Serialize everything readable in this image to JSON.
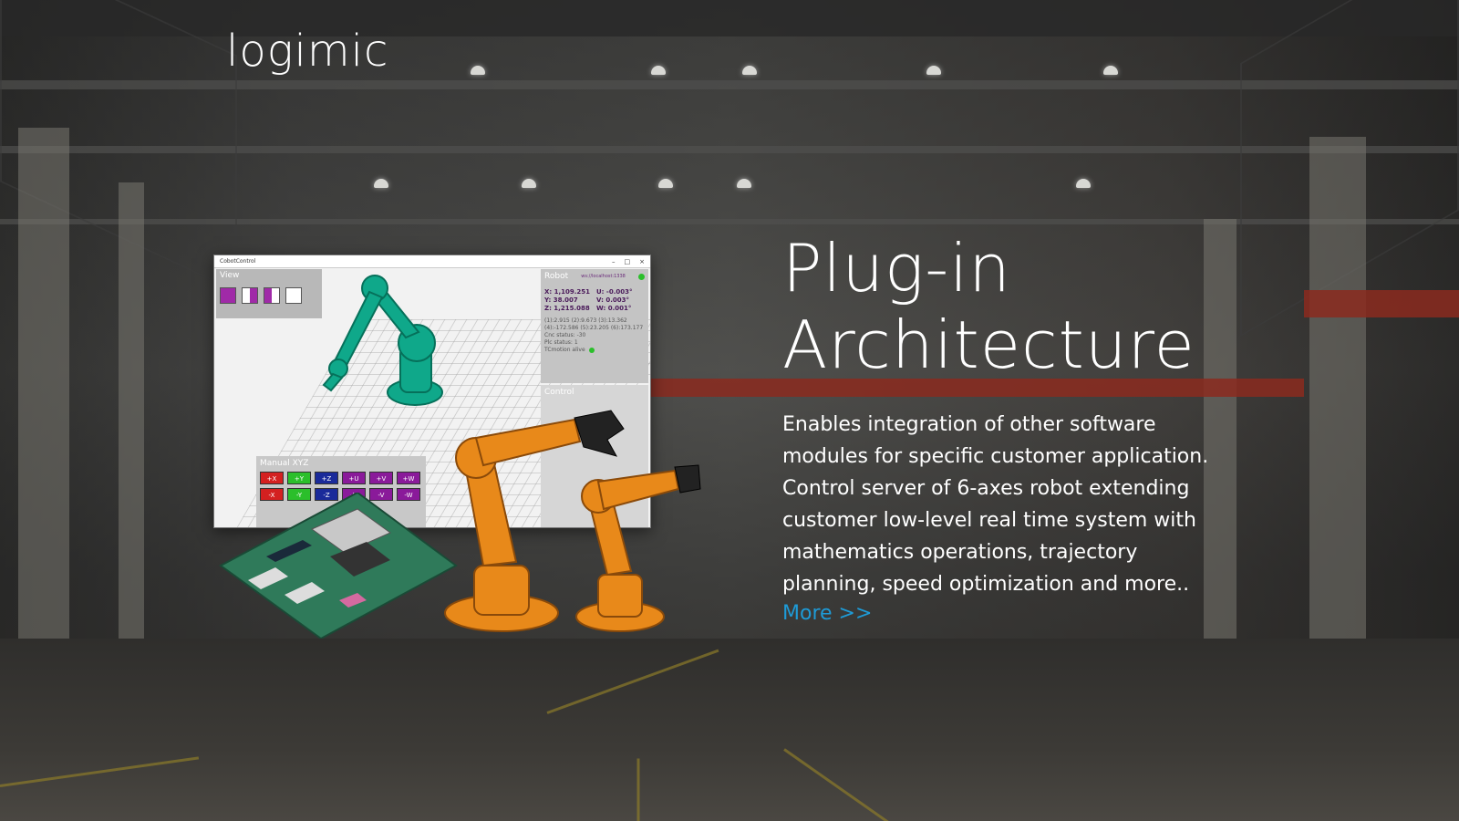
{
  "brand": {
    "logo_text": "logimic"
  },
  "hero": {
    "title_line1": "Plug-in",
    "title_line2": "Architecture",
    "description_lines": [
      "Enables integration of  other software",
      "modules for specific customer application.",
      "Control server of 6-axes robot extending",
      "customer low-level real time system with",
      "mathematics operations, trajectory",
      "planning, speed optimization and more.."
    ],
    "more_link": "More >>",
    "link_color": "#1e9bd7"
  },
  "app_window": {
    "title": "CobotControl",
    "window_controls": [
      "–",
      "□",
      "×"
    ],
    "view_panel_title": "View",
    "robot_panel": {
      "title": "Robot",
      "connection": "ws://localhost:1338",
      "coords": [
        "X: 1,109.251",
        "U: -0.003°",
        "Y: 38.007",
        "V: 0.003°",
        "Z: 1,215.088",
        "W: 0.001°"
      ],
      "joints_line1": "(1):2.915   (2):9.673   (3):13.362",
      "joints_line2": "(4):-172.586 (5):23.205 (6):173.177",
      "cnc_status": "Cnc status: -30",
      "plc_status": "Plc status: 1",
      "motion_alive": "TCmotion alive"
    },
    "control_panel_title": "Control",
    "manual_panel_title": "Manual XYZ",
    "jog_buttons": [
      {
        "label": "+X",
        "color": "#d42020"
      },
      {
        "label": "+Y",
        "color": "#2bbf2b"
      },
      {
        "label": "+Z",
        "color": "#1a2a9a"
      },
      {
        "label": "+U",
        "color": "#8a1a9a"
      },
      {
        "label": "+V",
        "color": "#8a1a9a"
      },
      {
        "label": "+W",
        "color": "#8a1a9a"
      },
      {
        "label": "-X",
        "color": "#d42020"
      },
      {
        "label": "-Y",
        "color": "#2bbf2b"
      },
      {
        "label": "-Z",
        "color": "#1a2a9a"
      },
      {
        "label": "-U",
        "color": "#8a1a9a"
      },
      {
        "label": "-V",
        "color": "#8a1a9a"
      },
      {
        "label": "-W",
        "color": "#8a1a9a"
      }
    ]
  },
  "colors": {
    "robot_teal": "#0fa88a",
    "robot_orange": "#e8891a",
    "board_green": "#2f7a5a"
  }
}
